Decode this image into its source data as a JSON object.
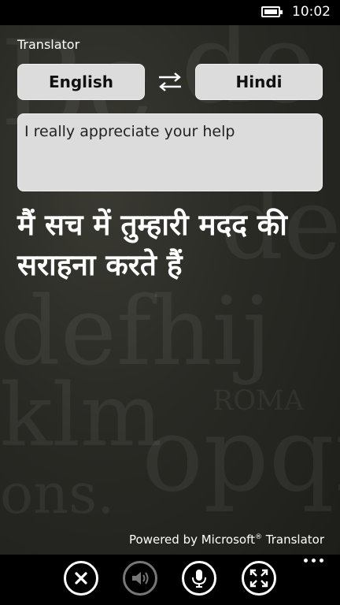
{
  "status_bar": {
    "time": "10:02"
  },
  "app": {
    "title": "Translator"
  },
  "languages": {
    "from": "English",
    "to": "Hindi"
  },
  "input": {
    "text": "I really appreciate your help"
  },
  "output": {
    "text": "मैं सच में तुम्हारी मदद की सराहना करते हैं"
  },
  "footer": {
    "powered_prefix": "Powered by Microsoft",
    "registered": "®",
    "powered_suffix": " Translator"
  },
  "app_bar": {
    "buttons": [
      {
        "icon": "close-icon",
        "enabled": true
      },
      {
        "icon": "speaker-icon",
        "enabled": false
      },
      {
        "icon": "microphone-icon",
        "enabled": true
      },
      {
        "icon": "fullscreen-icon",
        "enabled": true
      }
    ],
    "more": "more-icon"
  },
  "colors": {
    "button_bg": "#dcdcdc",
    "text_light": "#ffffff",
    "app_bar_bg": "#000000"
  }
}
